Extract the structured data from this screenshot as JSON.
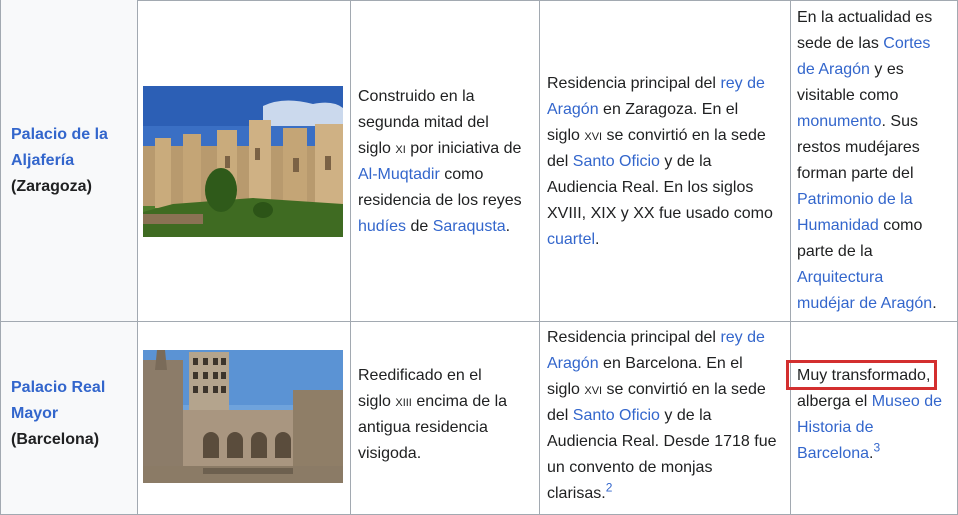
{
  "rows": [
    {
      "name": "Palacio de la Aljafería",
      "name_l1": "Palacio de la",
      "name_l2": "Aljafería",
      "location": "(Zaragoza)",
      "image_label": "Palacio de la Aljafería photo",
      "description": {
        "l1": "Construido en la",
        "l2": "segunda mitad del",
        "l3a": "siglo ",
        "l3b": "xi",
        "l3c": " por iniciativa de",
        "l4_link": "Al-Muqtadir",
        "l4_text": " como",
        "l5": "residencia de los reyes",
        "l6_link1": "hudíes",
        "l6_text": " de ",
        "l6_link2": "Saraqusta",
        "l6_end": "."
      },
      "function": {
        "l1_text": "Residencia principal del ",
        "l1_link": "rey de",
        "l2_link": "Aragón",
        "l2_text": " en Zaragoza. En el",
        "l3a": "siglo ",
        "l3b": "xvi",
        "l3c": " se convirtió en la sede",
        "l4_text": "del ",
        "l4_link": "Santo Oficio",
        "l4_end": " y de la",
        "l5": "Audiencia Real. En los siglos",
        "l6": "XVIII, XIX y XX fue usado como",
        "l7_link": "cuartel",
        "l7_end": "."
      },
      "state": {
        "l1": "En la actualidad es",
        "l2_text": "sede de las ",
        "l2_link": "Cortes",
        "l3_link": "de Aragón",
        "l3_text": " y es",
        "l4": "visitable como",
        "l5_link": "monumento",
        "l5_text": ". Sus",
        "l6": "restos mudéjares",
        "l7": "forman parte del",
        "l8_link": "Patrimonio de la",
        "l9_link": "Humanidad",
        "l9_text": " como",
        "l10": "parte de la",
        "l11_link": "Arquitectura",
        "l12_link": "mudéjar de Aragón",
        "l12_end": "."
      }
    },
    {
      "name": "Palacio Real Mayor",
      "name_l1": "Palacio Real",
      "name_l2": "Mayor",
      "location": "(Barcelona)",
      "image_label": "Palacio Real Mayor photo",
      "description": {
        "l1": "Reedificado en el",
        "l2a": "siglo ",
        "l2b": "xiii",
        "l2c": " encima de la",
        "l3": "antigua residencia",
        "l4": "visigoda."
      },
      "function": {
        "l1_text": "Residencia principal del ",
        "l1_link": "rey de",
        "l2_link": "Aragón",
        "l2_text": " en Barcelona. En el",
        "l3a": "siglo ",
        "l3b": "xvi",
        "l3c": " se convirtió en la sede",
        "l4_text": "del ",
        "l4_link": "Santo Oficio",
        "l4_end": " y de la",
        "l5": "Audiencia Real. Desde 1718 fue",
        "l6": "un convento de monjas",
        "l7": "clarisas.",
        "l7_sup": "2"
      },
      "state": {
        "l1": "Muy transformado,",
        "l2_text": "alberga el ",
        "l2_link": "Museo de",
        "l3_link": "Historia de",
        "l4_link": "Barcelona",
        "l4_end": ".",
        "l4_sup": "3"
      }
    }
  ],
  "colors": {
    "link": "#3366cc",
    "text": "#202122",
    "border": "#a2a9b1",
    "header_bg": "#f8f9fa",
    "highlight": "#d32f2f"
  }
}
